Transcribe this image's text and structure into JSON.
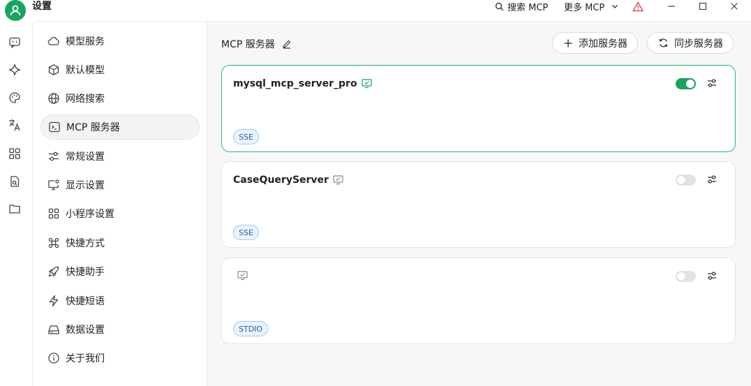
{
  "app": {
    "title": "设置"
  },
  "titlebar": {
    "search_label": "搜索 MCP",
    "more_label": "更多 MCP"
  },
  "sidebar": {
    "items": [
      {
        "label": "模型服务",
        "icon": "cloud-icon"
      },
      {
        "label": "默认模型",
        "icon": "cube-icon"
      },
      {
        "label": "网络搜索",
        "icon": "globe-icon"
      },
      {
        "label": "MCP 服务器",
        "icon": "terminal-icon",
        "active": true
      },
      {
        "label": "常规设置",
        "icon": "sliders-icon"
      },
      {
        "label": "显示设置",
        "icon": "monitor-gear-icon"
      },
      {
        "label": "小程序设置",
        "icon": "grid-icon"
      },
      {
        "label": "快捷方式",
        "icon": "command-icon"
      },
      {
        "label": "快捷助手",
        "icon": "rocket-icon"
      },
      {
        "label": "快捷短语",
        "icon": "bolt-icon"
      },
      {
        "label": "数据设置",
        "icon": "drive-icon"
      },
      {
        "label": "关于我们",
        "icon": "info-icon"
      }
    ]
  },
  "main": {
    "title": "MCP 服务器",
    "add_label": "添加服务器",
    "sync_label": "同步服务器",
    "servers": [
      {
        "name": "mysql_mcp_server_pro",
        "type": "SSE",
        "enabled": true
      },
      {
        "name": "CaseQueryServer",
        "type": "SSE",
        "enabled": false
      },
      {
        "name": "",
        "type": "STDIO",
        "enabled": false
      }
    ]
  },
  "colors": {
    "accent": "#19a35f",
    "active_border": "#2ab673",
    "tag_text": "#1b62a8",
    "tag_bg": "#e9f3fc"
  }
}
